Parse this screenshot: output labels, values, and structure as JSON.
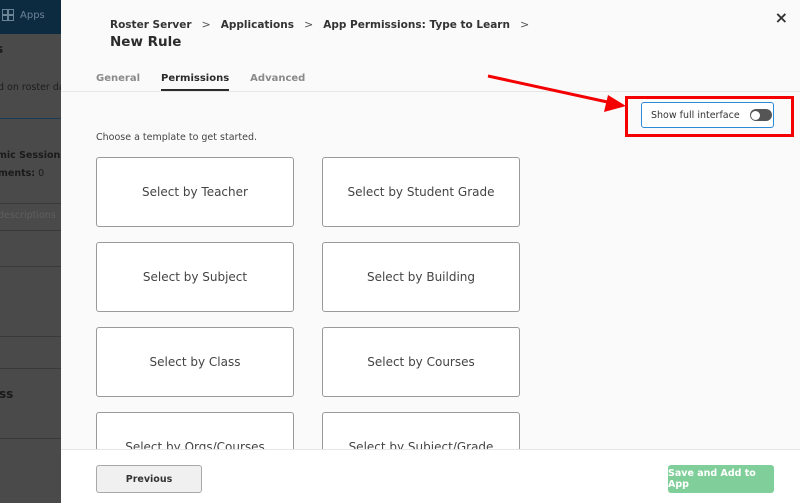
{
  "background_app": {
    "topbar_label": "Apps",
    "title_fragment": "s",
    "description_fragment": "d on roster da",
    "sessions_fragment": "mic Sessions",
    "comments_label_fragment": "ments:",
    "comments_value": "0",
    "descriptions_fragment": "descriptions",
    "section_fragment": "ss"
  },
  "modal": {
    "breadcrumb": [
      "Roster Server",
      "Applications",
      "App Permissions: Type to Learn"
    ],
    "breadcrumb_separator": ">",
    "title": "New Rule",
    "close_label": "×",
    "tabs": [
      {
        "label": "General",
        "active": false
      },
      {
        "label": "Permissions",
        "active": true
      },
      {
        "label": "Advanced",
        "active": false
      }
    ],
    "toggle": {
      "label": "Show full interface",
      "on": false
    },
    "hint": "Choose a template to get started.",
    "templates": [
      "Select by Teacher",
      "Select by Student Grade",
      "Select by Subject",
      "Select by Building",
      "Select by Class",
      "Select by Courses",
      "Select by Orgs/Courses",
      "Select by Subject/Grade"
    ],
    "footer": {
      "previous_label": "Previous",
      "save_label": "Save and Add to App"
    }
  },
  "colors": {
    "accent_blue": "#2d8ad6",
    "save_green": "#80cf9a",
    "annotation_red": "#f40000"
  }
}
